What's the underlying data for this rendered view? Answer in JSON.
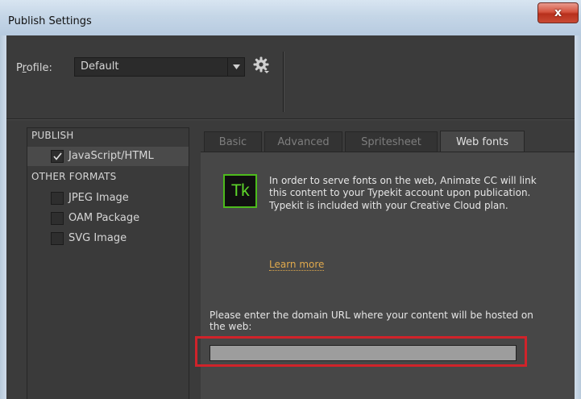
{
  "window": {
    "title": "Publish Settings",
    "close_label": "x"
  },
  "profile": {
    "label_prefix": "P",
    "label_underlined": "r",
    "label_suffix": "ofile:",
    "value": "Default"
  },
  "sidebar": {
    "publish_header": "PUBLISH",
    "publish_items": [
      {
        "label": "JavaScript/HTML",
        "checked": true
      }
    ],
    "other_header": "OTHER FORMATS",
    "other_items": [
      {
        "label": "JPEG Image",
        "checked": false
      },
      {
        "label": "OAM Package",
        "checked": false
      },
      {
        "label": "SVG Image",
        "checked": false
      }
    ]
  },
  "tabs": [
    {
      "label": "Basic",
      "active": false
    },
    {
      "label": "Advanced",
      "active": false
    },
    {
      "label": "Spritesheet",
      "active": false
    },
    {
      "label": "Web fonts",
      "active": true
    }
  ],
  "webfonts": {
    "logo_text": "Tk",
    "info": "In order to serve fonts on the web, Animate CC will link this content to your Typekit account upon publication. Typekit is included with your Creative Cloud plan.",
    "learn_more": "Learn more",
    "domain_prompt": "Please enter the domain URL where your content will be hosted on the web:",
    "domain_value": ""
  },
  "colors": {
    "panel_bg": "#474747",
    "typekit_green": "#5ed62a",
    "link_orange": "#e0a94d",
    "highlight_red": "#d0232a",
    "close_red": "#c94a34"
  }
}
